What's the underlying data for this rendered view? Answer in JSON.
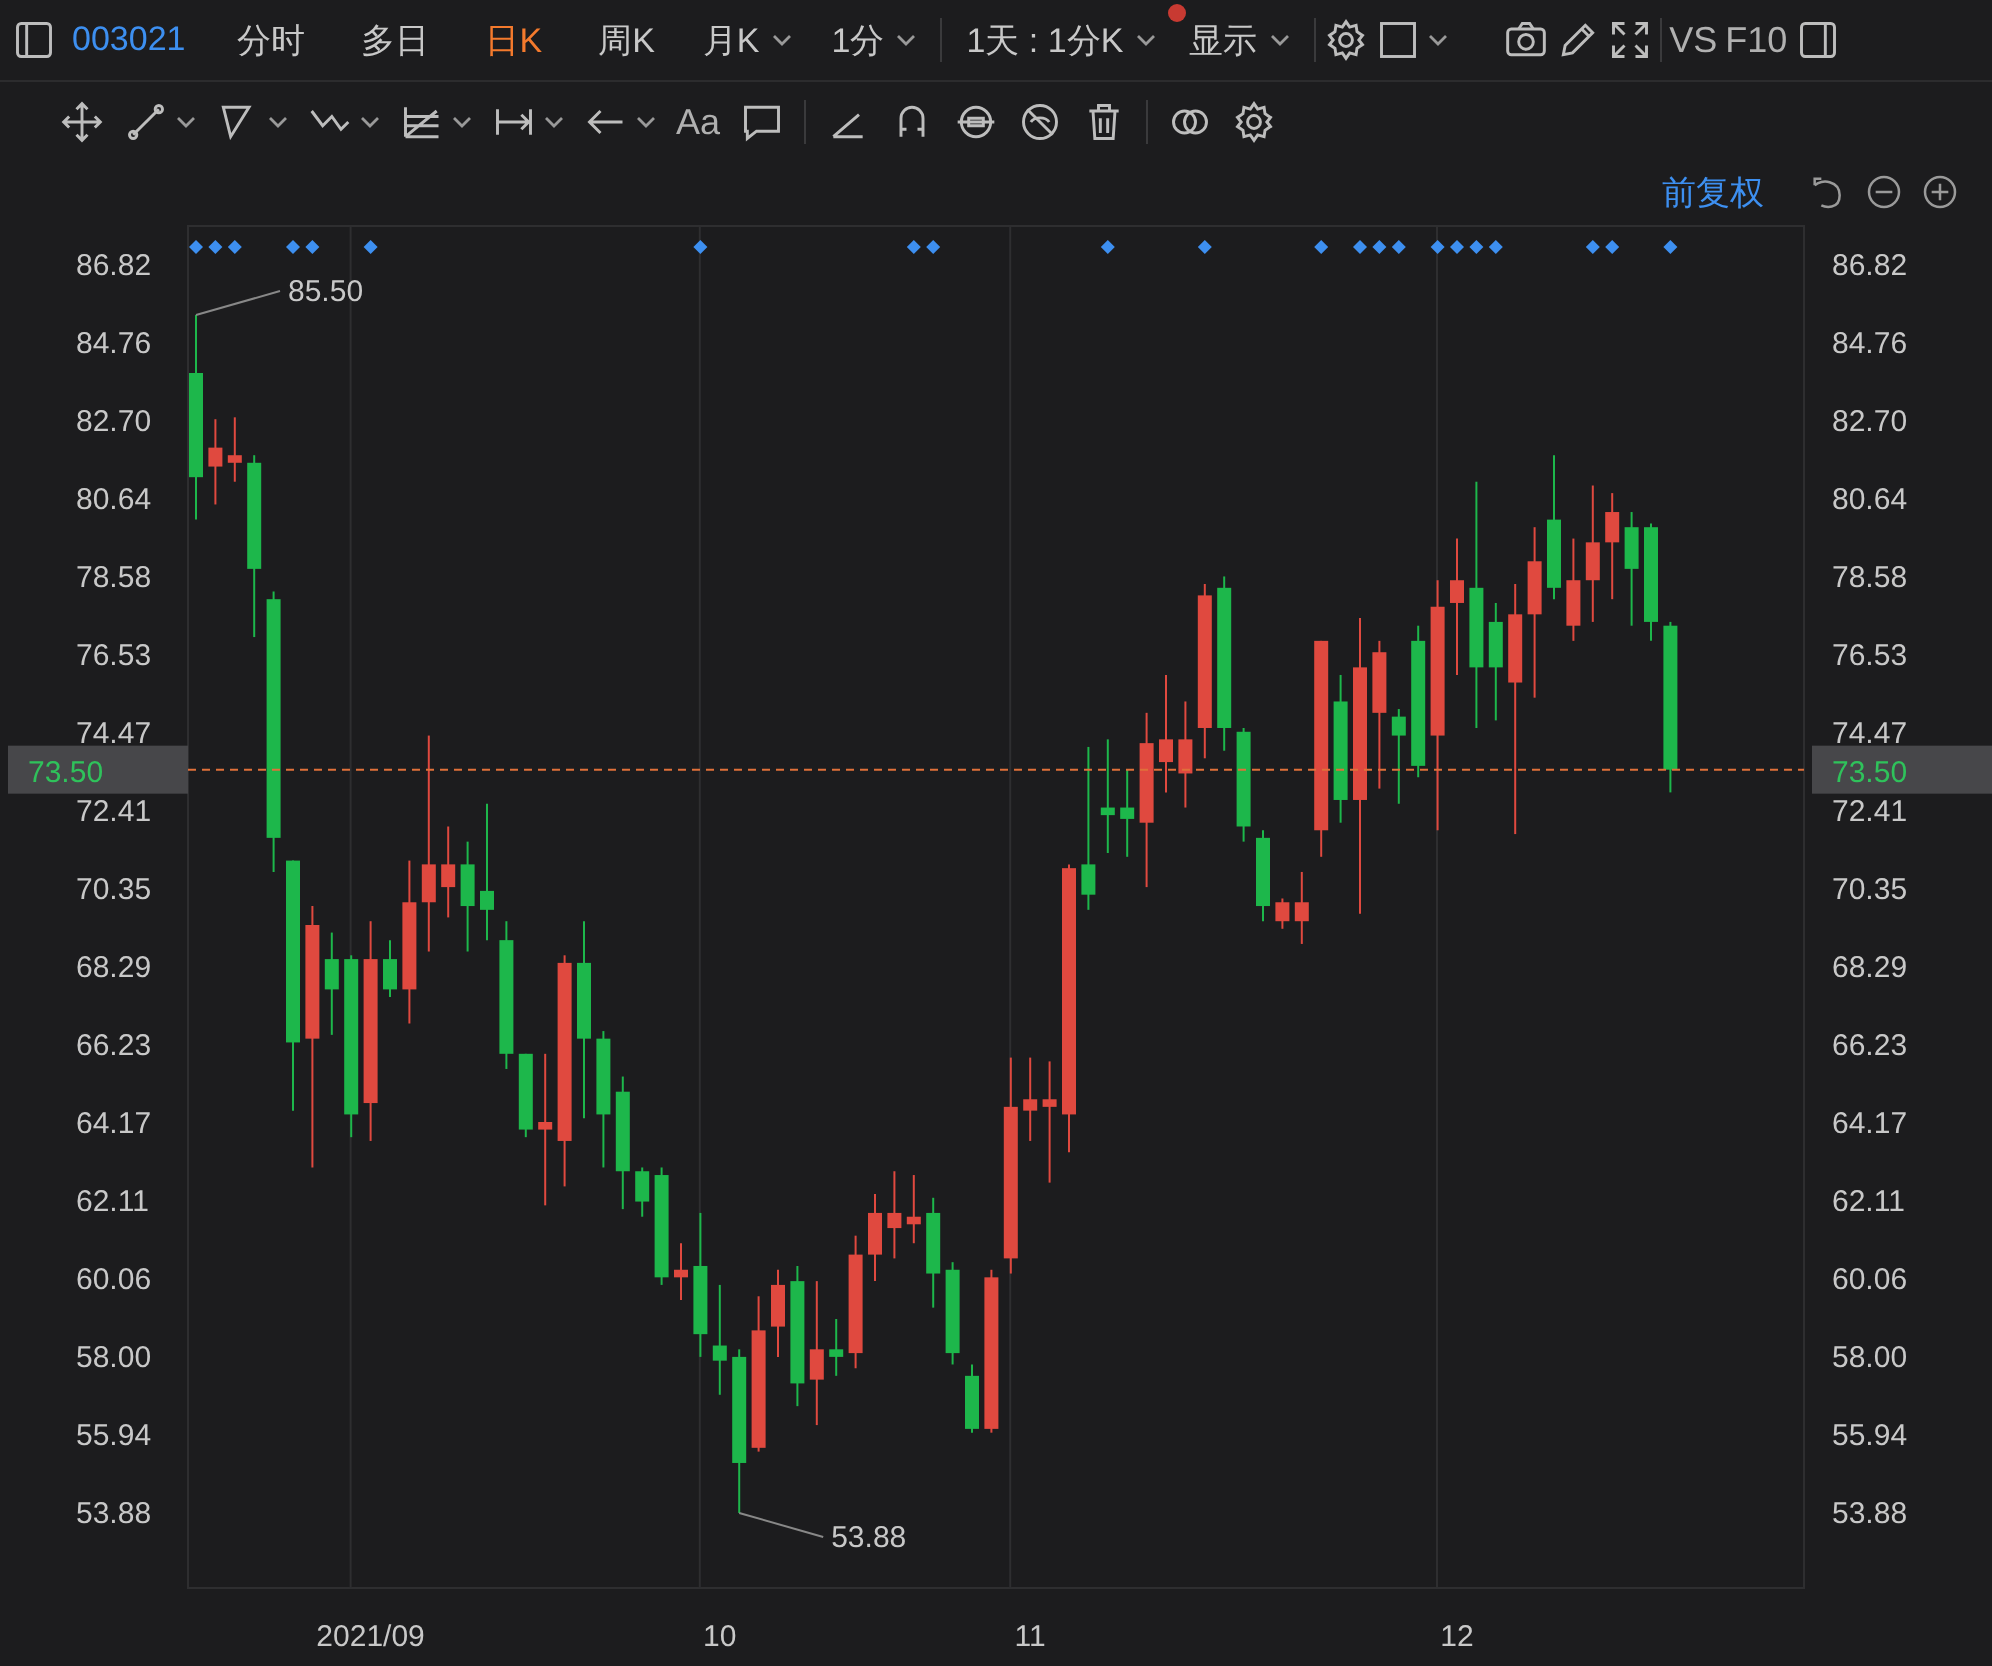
{
  "top_bar": {
    "code": "003021",
    "tabs": [
      {
        "label": "分时",
        "selected": false
      },
      {
        "label": "多日",
        "selected": false
      },
      {
        "label": "日K",
        "selected": true
      },
      {
        "label": "周K",
        "selected": false
      }
    ],
    "dropdowns": [
      {
        "label": "月K",
        "notification_dot": false
      },
      {
        "label": "1分",
        "notification_dot": false
      },
      {
        "label": "1天 : 1分K",
        "notification_dot": false
      },
      {
        "label": "显示",
        "notification_dot": true
      }
    ],
    "vs": "VS",
    "f10": "F10"
  },
  "drawing_toolbar": {
    "text_tool": "Aa"
  },
  "chart_header": {
    "adjust": "前复权"
  },
  "chart_data": {
    "type": "candlestick",
    "categories": [
      null,
      null,
      null,
      null,
      null,
      null,
      null,
      null,
      null,
      "2021/09",
      null,
      null,
      null,
      null,
      null,
      null,
      null,
      null,
      null,
      null,
      null,
      null,
      null,
      null,
      null,
      null,
      null,
      "10",
      null,
      null,
      null,
      null,
      null,
      null,
      null,
      null,
      null,
      null,
      null,
      null,
      null,
      null,
      null,
      "11",
      null,
      null,
      null,
      null,
      null,
      null,
      null,
      null,
      null,
      null,
      null,
      null,
      null,
      null,
      null,
      null,
      null,
      null,
      null,
      null,
      null,
      "12",
      null,
      null,
      null,
      null,
      null,
      null,
      null,
      null,
      null,
      null,
      null
    ],
    "ohlc": [
      [
        83.97,
        85.5,
        80.1,
        81.22
      ],
      [
        81.5,
        82.75,
        80.5,
        82.0
      ],
      [
        81.6,
        82.8,
        81.1,
        81.8
      ],
      [
        81.6,
        81.8,
        77.0,
        78.8
      ],
      [
        78.0,
        78.2,
        70.8,
        71.7
      ],
      [
        71.1,
        71.1,
        64.5,
        66.3
      ],
      [
        66.4,
        69.9,
        63.0,
        69.4
      ],
      [
        68.5,
        69.2,
        66.5,
        67.7
      ],
      [
        68.5,
        68.6,
        63.8,
        64.4
      ],
      [
        64.7,
        69.5,
        63.7,
        68.5
      ],
      [
        68.5,
        69.0,
        67.5,
        67.7
      ],
      [
        67.7,
        71.1,
        66.8,
        70.0
      ],
      [
        70.0,
        74.4,
        68.7,
        71.0
      ],
      [
        70.4,
        72.0,
        69.6,
        71.0
      ],
      [
        71.0,
        71.6,
        68.7,
        69.9
      ],
      [
        70.3,
        72.6,
        69.0,
        69.8
      ],
      [
        69.0,
        69.5,
        65.6,
        66.0
      ],
      [
        66.0,
        66.0,
        63.8,
        64.0
      ],
      [
        64.0,
        66.0,
        62.0,
        64.2
      ],
      [
        63.7,
        68.6,
        62.5,
        68.4
      ],
      [
        68.4,
        69.5,
        64.3,
        66.4
      ],
      [
        66.4,
        66.6,
        63.0,
        64.4
      ],
      [
        65.0,
        65.4,
        61.9,
        62.9
      ],
      [
        62.9,
        63.0,
        61.7,
        62.1
      ],
      [
        62.8,
        63.0,
        59.9,
        60.1
      ],
      [
        60.1,
        61.0,
        59.5,
        60.3
      ],
      [
        60.4,
        61.8,
        58.0,
        58.6
      ],
      [
        58.3,
        59.9,
        57.0,
        57.9
      ],
      [
        58.0,
        58.2,
        53.88,
        55.2
      ],
      [
        55.6,
        59.6,
        55.5,
        58.7
      ],
      [
        58.8,
        60.3,
        58.0,
        59.9
      ],
      [
        60.0,
        60.4,
        56.7,
        57.3
      ],
      [
        57.4,
        60.0,
        56.2,
        58.2
      ],
      [
        58.2,
        59.0,
        57.5,
        58.0
      ],
      [
        58.1,
        61.2,
        57.7,
        60.7
      ],
      [
        60.7,
        62.3,
        60.0,
        61.8
      ],
      [
        61.4,
        62.9,
        60.6,
        61.8
      ],
      [
        61.5,
        62.8,
        61.0,
        61.7
      ],
      [
        61.8,
        62.2,
        59.3,
        60.2
      ],
      [
        60.3,
        60.5,
        57.8,
        58.1
      ],
      [
        57.5,
        57.8,
        56.0,
        56.1
      ],
      [
        56.1,
        60.3,
        56.0,
        60.1
      ],
      [
        60.6,
        65.9,
        60.2,
        64.6
      ],
      [
        64.5,
        65.9,
        63.7,
        64.8
      ],
      [
        64.6,
        65.8,
        62.6,
        64.8
      ],
      [
        64.4,
        71.0,
        63.4,
        70.9
      ],
      [
        71.0,
        74.1,
        69.8,
        70.2
      ],
      [
        72.5,
        74.3,
        71.3,
        72.3
      ],
      [
        72.5,
        73.5,
        71.2,
        72.2
      ],
      [
        72.1,
        75.0,
        70.4,
        74.2
      ],
      [
        73.7,
        76.0,
        72.9,
        74.3
      ],
      [
        73.4,
        75.3,
        72.5,
        74.3
      ],
      [
        74.6,
        78.4,
        73.8,
        78.1
      ],
      [
        78.3,
        78.6,
        74.0,
        74.6
      ],
      [
        74.5,
        74.6,
        71.6,
        72.0
      ],
      [
        71.7,
        71.9,
        69.5,
        69.9
      ],
      [
        69.5,
        70.1,
        69.3,
        70.0
      ],
      [
        69.5,
        70.8,
        68.9,
        70.0
      ],
      [
        71.9,
        76.9,
        71.2,
        76.9
      ],
      [
        75.3,
        76.0,
        72.1,
        72.7
      ],
      [
        72.7,
        77.5,
        69.7,
        76.2
      ],
      [
        75.0,
        76.9,
        73.0,
        76.6
      ],
      [
        74.9,
        75.1,
        72.6,
        74.4
      ],
      [
        76.9,
        77.3,
        73.3,
        73.6
      ],
      [
        74.4,
        78.5,
        71.9,
        77.8
      ],
      [
        77.9,
        79.6,
        76.0,
        78.5
      ],
      [
        78.3,
        81.1,
        74.6,
        76.2
      ],
      [
        77.4,
        77.9,
        74.8,
        76.2
      ],
      [
        75.8,
        78.4,
        71.8,
        77.6
      ],
      [
        77.6,
        79.9,
        75.4,
        79.0
      ],
      [
        80.1,
        81.8,
        78.0,
        78.3
      ],
      [
        77.3,
        79.6,
        76.9,
        78.5
      ],
      [
        78.5,
        81.0,
        77.4,
        79.5
      ],
      [
        79.5,
        80.8,
        78.0,
        80.3
      ],
      [
        79.9,
        80.3,
        77.3,
        78.8
      ],
      [
        79.9,
        80.0,
        76.9,
        77.4
      ],
      [
        77.3,
        77.4,
        72.9,
        73.5
      ]
    ],
    "ylim": [
      51.9,
      87.85
    ],
    "yticks": [
      {
        "value": 86.82,
        "label": "86.82"
      },
      {
        "value": 84.76,
        "label": "84.76"
      },
      {
        "value": 82.7,
        "label": "82.70"
      },
      {
        "value": 80.64,
        "label": "80.64"
      },
      {
        "value": 78.58,
        "label": "78.58"
      },
      {
        "value": 76.53,
        "label": "76.53"
      },
      {
        "value": 74.47,
        "label": "74.47"
      },
      {
        "value": 72.41,
        "label": "72.41"
      },
      {
        "value": 70.35,
        "label": "70.35"
      },
      {
        "value": 68.29,
        "label": "68.29"
      },
      {
        "value": 66.23,
        "label": "66.23"
      },
      {
        "value": 64.17,
        "label": "64.17"
      },
      {
        "value": 62.11,
        "label": "62.11"
      },
      {
        "value": 60.06,
        "label": "60.06"
      },
      {
        "value": 58.0,
        "label": "58.00"
      },
      {
        "value": 55.94,
        "label": "55.94"
      },
      {
        "value": 53.88,
        "label": "53.88"
      }
    ],
    "ref_lines": [
      {
        "axis": "y",
        "value": 73.5,
        "label": "73.50"
      }
    ],
    "annotations": [
      "85.50",
      "53.88"
    ]
  },
  "event_row": {
    "markers": [
      true,
      true,
      true,
      false,
      false,
      true,
      true,
      false,
      false,
      true,
      false,
      false,
      false,
      false,
      false,
      false,
      false,
      false,
      false,
      false,
      false,
      false,
      false,
      false,
      false,
      false,
      true,
      false,
      false,
      false,
      false,
      false,
      false,
      false,
      false,
      false,
      false,
      true,
      true,
      false,
      false,
      false,
      false,
      false,
      false,
      false,
      false,
      true,
      false,
      false,
      false,
      false,
      true,
      false,
      false,
      false,
      false,
      false,
      true,
      false,
      true,
      true,
      true,
      false,
      true,
      true,
      true,
      true,
      false,
      false,
      false,
      false,
      true,
      true,
      false,
      false,
      true
    ]
  }
}
